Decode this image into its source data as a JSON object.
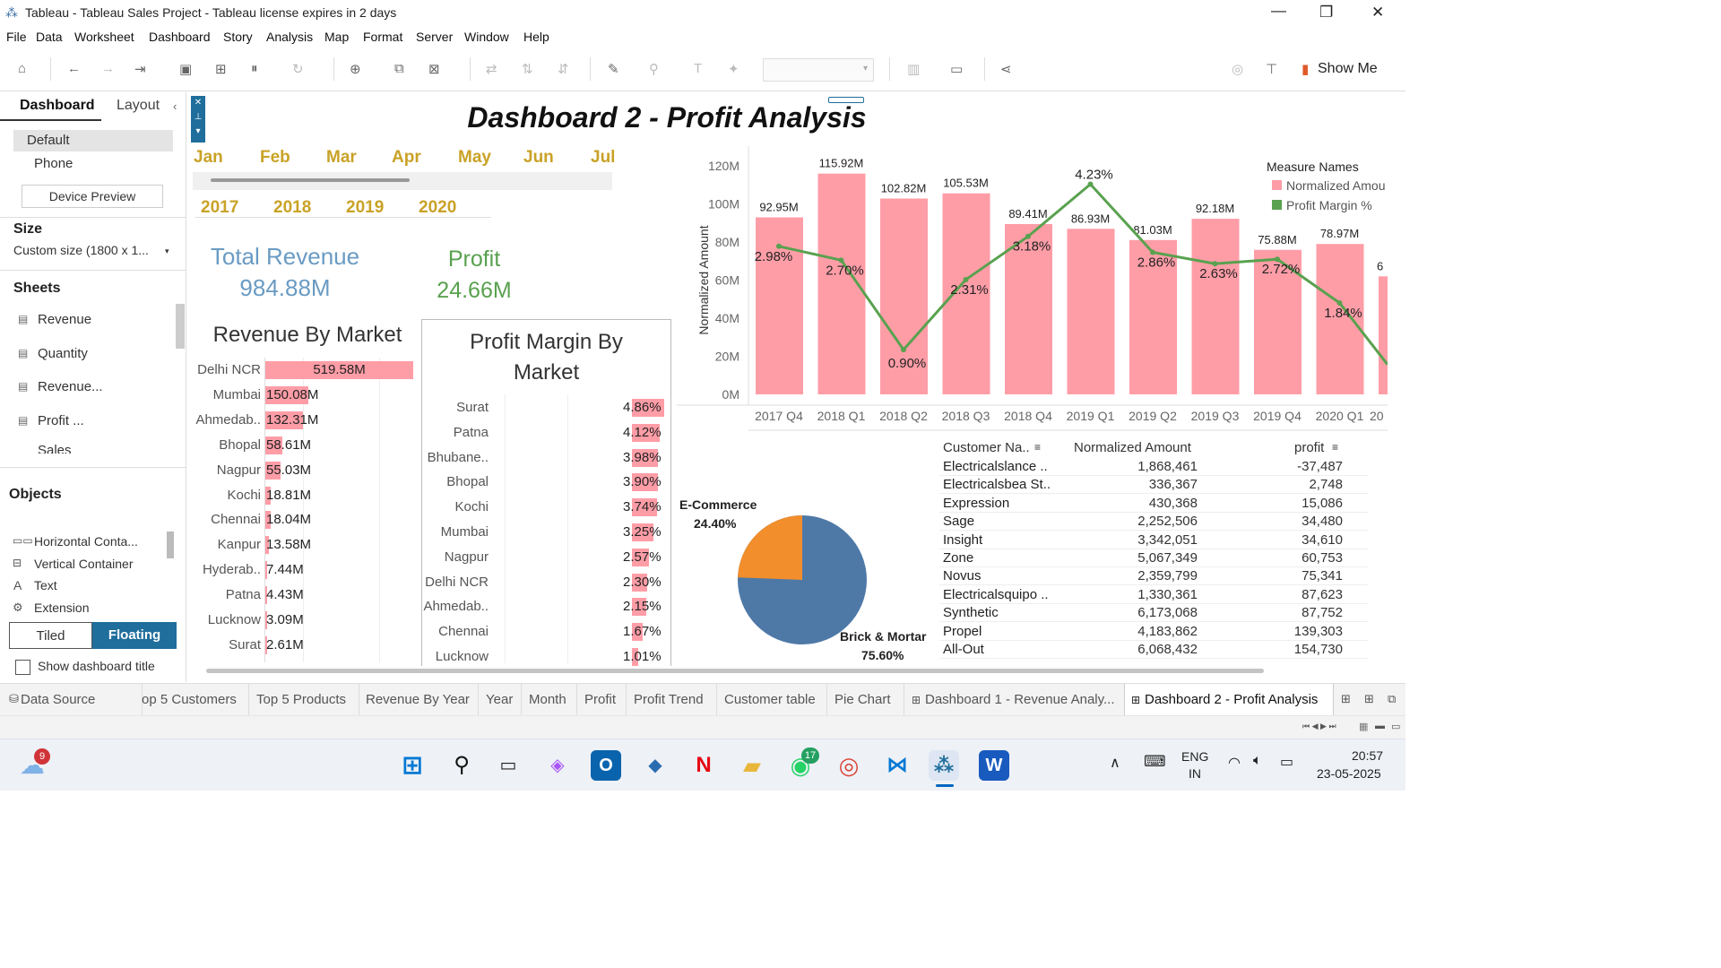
{
  "window": {
    "title": "Tableau - Tableau Sales Project - Tableau license expires in 2 days"
  },
  "menu": [
    "File",
    "Data",
    "Worksheet",
    "Dashboard",
    "Story",
    "Analysis",
    "Map",
    "Format",
    "Server",
    "Window",
    "Help"
  ],
  "toolbar": {
    "show_me": "Show Me"
  },
  "left_pane": {
    "tab_dashboard": "Dashboard",
    "tab_layout": "Layout",
    "device_default": "Default",
    "device_phone": "Phone",
    "device_preview": "Device Preview",
    "size_heading": "Size",
    "size_value": "Custom size (1800 x 1...",
    "sheets_heading": "Sheets",
    "sheets": [
      "Revenue",
      "Quantity",
      "Revenue...",
      "Profit ...",
      "Sales"
    ],
    "objects_heading": "Objects",
    "objects": [
      "Horizontal Conta...",
      "Vertical Container",
      "Text",
      "Extension"
    ],
    "tiled": "Tiled",
    "floating": "Floating",
    "show_title": "Show dashboard title"
  },
  "dashboard": {
    "title": "Dashboard 2 - Profit Analysis",
    "months": [
      "Jan",
      "Feb",
      "Mar",
      "Apr",
      "May",
      "Jun",
      "Jul"
    ],
    "years": [
      "2017",
      "2018",
      "2019",
      "2020"
    ],
    "kpi": {
      "revenue_label": "Total Revenue",
      "revenue_value": "984.88M",
      "profit_label": "Profit",
      "profit_value": "24.66M"
    },
    "rev_market": {
      "title": "Revenue By Market",
      "rows": [
        [
          "Delhi NCR",
          "519.58M",
          519.58
        ],
        [
          "Mumbai",
          "150.08M",
          150.08
        ],
        [
          "Ahmedab..",
          "132.31M",
          132.31
        ],
        [
          "Bhopal",
          "58.61M",
          58.61
        ],
        [
          "Nagpur",
          "55.03M",
          55.03
        ],
        [
          "Kochi",
          "18.81M",
          18.81
        ],
        [
          "Chennai",
          "18.04M",
          18.04
        ],
        [
          "Kanpur",
          "13.58M",
          13.58
        ],
        [
          "Hyderab..",
          "7.44M",
          7.44
        ],
        [
          "Patna",
          "4.43M",
          4.43
        ],
        [
          "Lucknow",
          "3.09M",
          3.09
        ],
        [
          "Surat",
          "2.61M",
          2.61
        ]
      ]
    },
    "margin_market": {
      "title_line1": "Profit Margin By",
      "title_line2": "Market",
      "rows": [
        [
          "Surat",
          "4.86%",
          4.86
        ],
        [
          "Patna",
          "4.12%",
          4.12
        ],
        [
          "Bhubane..",
          "3.98%",
          3.98
        ],
        [
          "Bhopal",
          "3.90%",
          3.9
        ],
        [
          "Kochi",
          "3.74%",
          3.74
        ],
        [
          "Mumbai",
          "3.25%",
          3.25
        ],
        [
          "Nagpur",
          "2.57%",
          2.57
        ],
        [
          "Delhi NCR",
          "2.30%",
          2.3
        ],
        [
          "Ahmedab..",
          "2.15%",
          2.15
        ],
        [
          "Chennai",
          "1.67%",
          1.67
        ],
        [
          "Lucknow",
          "1.01%",
          1.01
        ]
      ]
    },
    "pie": {
      "ecom_label": "E-Commerce",
      "ecom_value": "24.40%",
      "bm_label": "Brick & Mortar",
      "bm_value": "75.60%",
      "ecom_pct": 24.4,
      "colors": {
        "ecom": "#f28e2b",
        "bm": "#4e79a7"
      }
    },
    "table": {
      "headers": [
        "Customer Na..",
        "Normalized Amount",
        "profit"
      ],
      "rows": [
        [
          "Electricalslance ..",
          "1,868,461",
          "-37,487"
        ],
        [
          "Electricalsbea St..",
          "336,367",
          "2,748"
        ],
        [
          "Expression",
          "430,368",
          "15,086"
        ],
        [
          "Sage",
          "2,252,506",
          "34,480"
        ],
        [
          "Insight",
          "3,342,051",
          "34,610"
        ],
        [
          "Zone",
          "5,067,349",
          "60,753"
        ],
        [
          "Novus",
          "2,359,799",
          "75,341"
        ],
        [
          "Electricalsquipo ..",
          "1,330,361",
          "87,623"
        ],
        [
          "Synthetic",
          "6,173,068",
          "87,752"
        ],
        [
          "Propel",
          "4,183,862",
          "139,303"
        ],
        [
          "All-Out",
          "6,068,432",
          "154,730"
        ]
      ]
    }
  },
  "chart_data": {
    "type": "bar",
    "categories": [
      "2017 Q4",
      "2018 Q1",
      "2018 Q2",
      "2018 Q3",
      "2018 Q4",
      "2019 Q1",
      "2019 Q2",
      "2019 Q3",
      "2019 Q4",
      "2020 Q1"
    ],
    "series": [
      {
        "name": "Normalized Amount",
        "values": [
          92.95,
          115.92,
          102.82,
          105.53,
          89.41,
          86.93,
          81.03,
          92.18,
          75.88,
          78.97
        ],
        "labels": [
          "92.95M",
          "115.92M",
          "102.82M",
          "105.53M",
          "89.41M",
          "86.93M",
          "81.03M",
          "92.18M",
          "75.88M",
          "78.97M"
        ],
        "color": "#ff9da7"
      },
      {
        "name": "Profit Margin %",
        "values": [
          2.98,
          2.7,
          0.9,
          2.31,
          3.18,
          4.23,
          2.86,
          2.63,
          2.72,
          1.84
        ],
        "labels": [
          "2.98%",
          "2.70%",
          "0.90%",
          "2.31%",
          "3.18%",
          "4.23%",
          "2.86%",
          "2.63%",
          "2.72%",
          "1.84%"
        ],
        "color": "#59a14f"
      }
    ],
    "ylabel": "Normalized Amount",
    "yticks": [
      "120M",
      "100M",
      "80M",
      "60M",
      "40M",
      "20M",
      "0M"
    ],
    "ylim": [
      0,
      120
    ],
    "legend_title": "Measure Names",
    "legend_items": [
      "Normalized Amou",
      "Profit Margin %"
    ],
    "legend": "top-right"
  },
  "bottom_tabs": [
    "Data Source",
    "op 5 Customers",
    "Top 5 Products",
    "Revenue By Year",
    "Year",
    "Month",
    "Profit",
    "Profit Trend",
    "Customer table",
    "Pie Chart",
    "Dashboard 1 - Revenue Analy...",
    "Dashboard 2 - Profit Analysis"
  ],
  "taskbar": {
    "lang1": "ENG",
    "lang2": "IN",
    "time": "20:57",
    "date": "23-05-2025",
    "weather_badge": "9",
    "whatsapp_badge": "17"
  }
}
